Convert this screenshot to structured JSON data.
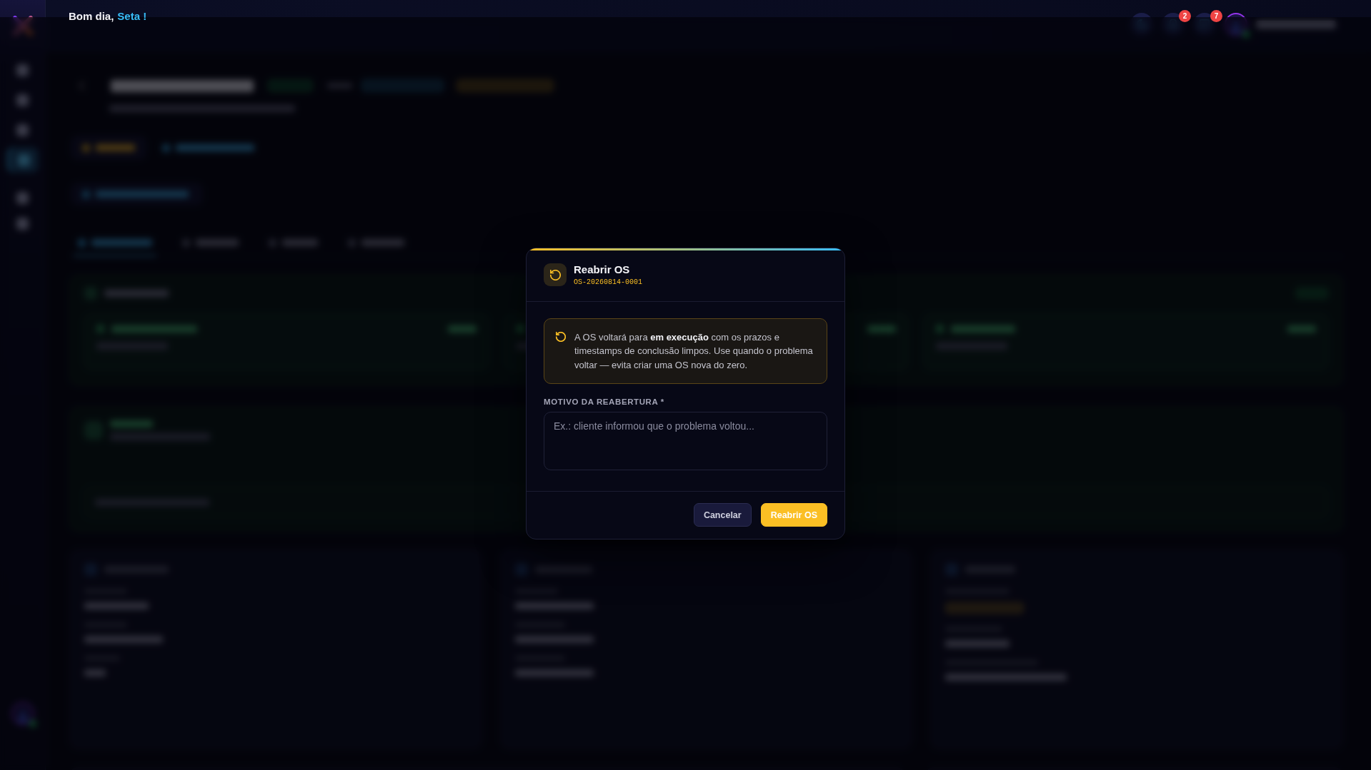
{
  "sidebar": {
    "items": [
      {
        "selected": false
      },
      {
        "selected": false
      },
      {
        "selected": false
      },
      {
        "selected": true
      },
      {
        "selected": false
      },
      {
        "selected": false
      }
    ],
    "profile": {
      "online": true
    }
  },
  "header": {
    "greeting": "Bom dia,",
    "name": "Seta !",
    "icon_buttons": [
      {
        "kind": "plain"
      },
      {
        "kind": "notify",
        "badge": "2"
      },
      {
        "kind": "notify",
        "badge": "7"
      }
    ],
    "user": {
      "online": true
    }
  },
  "dialog": {
    "title": "Reabrir OS",
    "subtitle": "OS-20260814-0001",
    "notice": "A OS voltará para **em execução** com os prazos e timestamps de conclusão limpos. Use quando o problema voltar — evita criar uma OS nova do zero.",
    "field": {
      "label": "MOTIVO DA REABERTURA *",
      "placeholder": "Ex.: cliente informou que o problema voltou..."
    },
    "buttons": [
      {
        "label": "Cancelar",
        "kind": "secondary"
      },
      {
        "label": "Reabrir OS",
        "kind": "primary"
      }
    ]
  }
}
